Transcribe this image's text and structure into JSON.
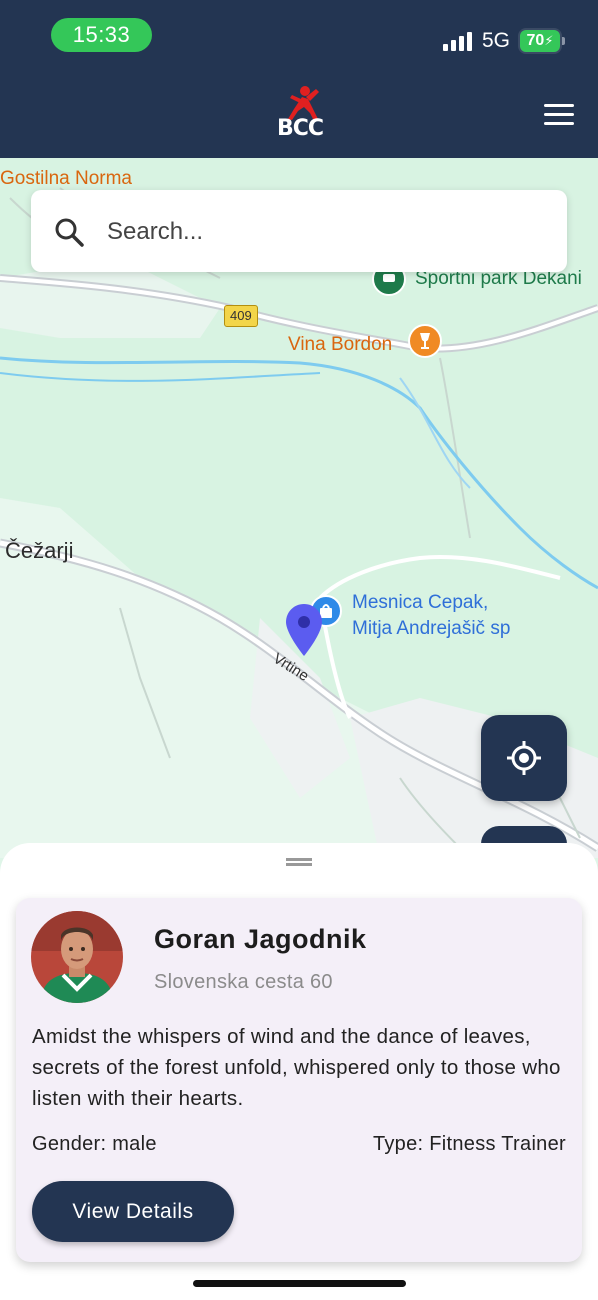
{
  "status_bar": {
    "time": "15:33",
    "network": "5G",
    "battery": "70"
  },
  "header": {
    "logo_text": "BCC",
    "menu_icon": "hamburger-menu-icon",
    "background_color": "#233552"
  },
  "search": {
    "placeholder": "Search...",
    "icon": "search-icon"
  },
  "map": {
    "labels": {
      "gostilna": "Gostilna Norma",
      "sportni": "Sportni park Dekani",
      "road_number": "409",
      "vina": "Vina Bordon",
      "village": "Čežarji",
      "mesnica_line1": "Mesnica Cepak,",
      "mesnica_line2": "Mitja Andrejašič sp",
      "street": "Vrtine"
    },
    "marker_color": "#5b5cf0"
  },
  "controls": {
    "locate_icon": "my-location-icon"
  },
  "profile_card": {
    "name": "Goran Jagodnik",
    "address": "Slovenska cesta 60",
    "description": "Amidst the whispers of wind and the dance of leaves, secrets of the forest unfold, whispered only to those who listen with their hearts.",
    "gender": "Gender: male",
    "type": "Type: Fitness Trainer",
    "button_label": "View Details"
  }
}
